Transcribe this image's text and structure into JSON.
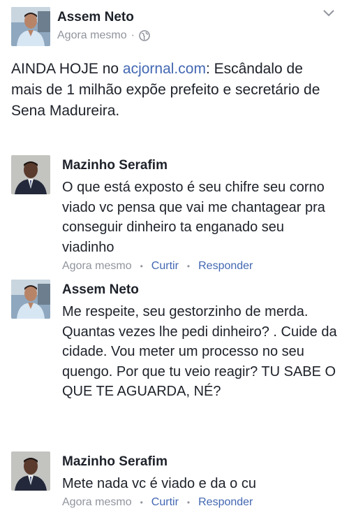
{
  "post": {
    "author": "Assem Neto",
    "time": "Agora mesmo",
    "separator": "·",
    "text_before": "AINDA HOJE no ",
    "link": "acjornal.com",
    "text_after": ": Escândalo de mais de 1 milhão expõe prefeito e secretário de Sena Madureira."
  },
  "comments": [
    {
      "author": "Mazinho Serafim",
      "text": "O que está exposto é seu chifre seu corno viado vc pensa que vai me chantagear pra conseguir dinheiro ta enganado seu viadinho",
      "time": "Agora mesmo",
      "like": "Curtir",
      "reply": "Responder",
      "dot": "•"
    },
    {
      "author": "Assem Neto",
      "text": "Me respeite, seu gestorzinho de merda. Quantas vezes lhe pedi dinheiro? . Cuide da cidade. Vou meter um processo no seu quengo. Por que tu veio reagir? TU SABE O QUE TE AGUARDA, NÉ?"
    },
    {
      "author": "Mazinho Serafim",
      "text": "Mete nada vc é viado e da o cu",
      "time": "Agora mesmo",
      "like": "Curtir",
      "reply": "Responder",
      "dot": "•"
    }
  ],
  "colors": {
    "text": "#1d2129",
    "meta": "#90949c",
    "link": "#4267b2"
  }
}
